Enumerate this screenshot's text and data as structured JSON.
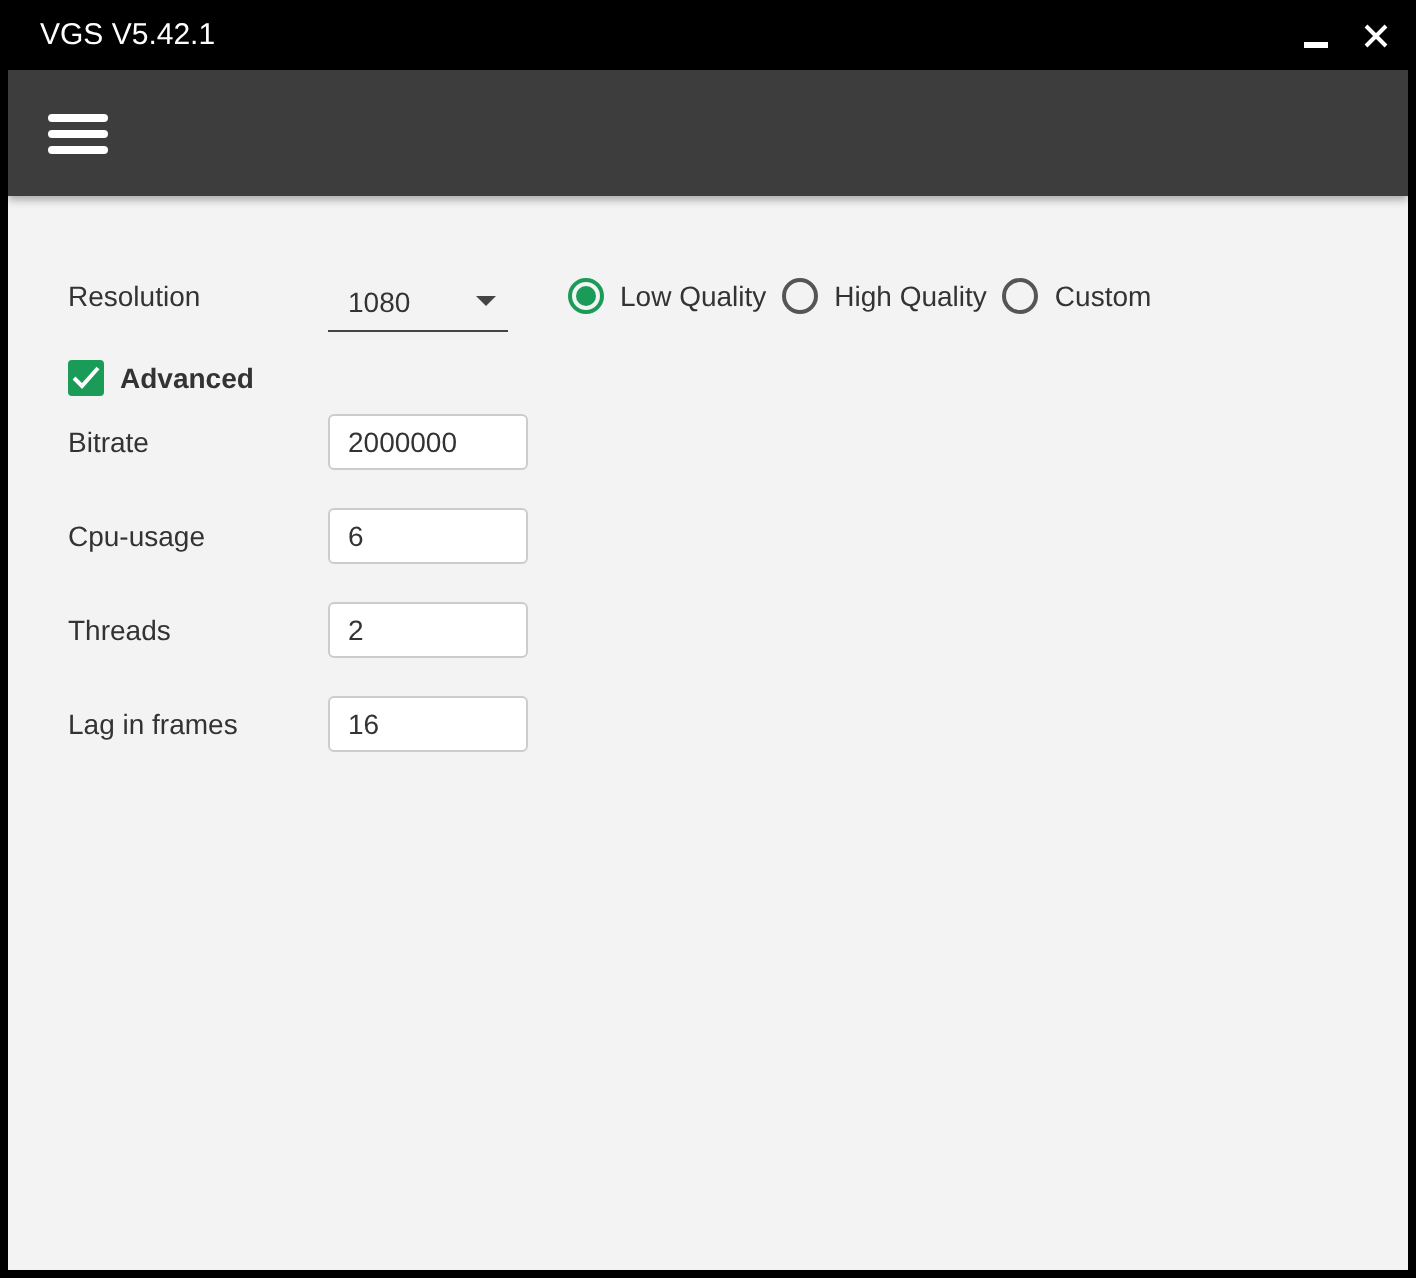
{
  "window": {
    "title": "VGS V5.42.1"
  },
  "resolution": {
    "label": "Resolution",
    "value": "1080"
  },
  "quality": [
    {
      "label": "Low Quality",
      "selected": true
    },
    {
      "label": "High Quality",
      "selected": false
    },
    {
      "label": "Custom",
      "selected": false
    }
  ],
  "advanced": {
    "label": "Advanced",
    "checked": true
  },
  "fields": [
    {
      "label": "Bitrate",
      "value": "2000000"
    },
    {
      "label": "Cpu-usage",
      "value": "6"
    },
    {
      "label": "Threads",
      "value": "2"
    },
    {
      "label": "Lag in frames",
      "value": "16"
    }
  ]
}
